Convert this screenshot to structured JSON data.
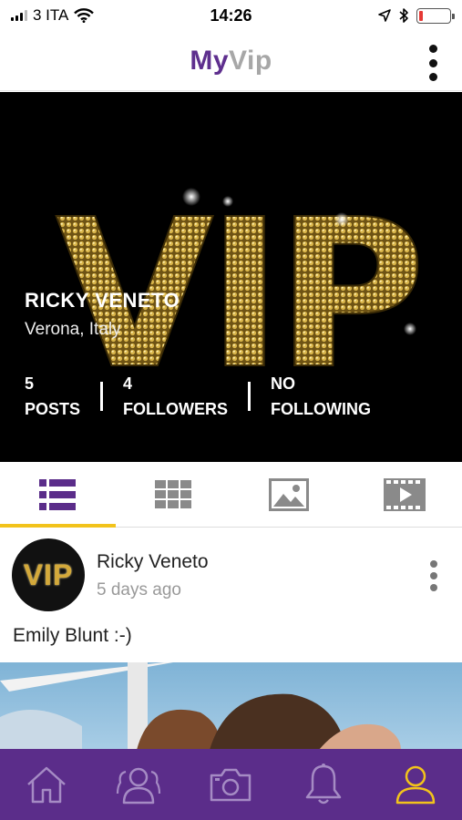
{
  "status_bar": {
    "carrier": "3 ITA",
    "time": "14:26",
    "battery_level": 0.12,
    "icons": [
      "signal-icon",
      "wifi-icon",
      "location-arrow-icon",
      "bluetooth-icon",
      "battery-icon"
    ]
  },
  "header": {
    "title_part1": "My",
    "title_part2": "Vip",
    "menu_icon": "vertical-dots-icon"
  },
  "profile": {
    "cover_text": "VIP",
    "name": "RICKY VENETO",
    "location": "Verona, Italy",
    "stats": [
      {
        "value": "5",
        "label": "POSTS"
      },
      {
        "value": "4",
        "label": "FOLLOWERS"
      },
      {
        "value": "NO",
        "label": "FOLLOWING"
      }
    ]
  },
  "tabs": [
    {
      "icon": "list-icon",
      "active": true
    },
    {
      "icon": "grid-icon",
      "active": false
    },
    {
      "icon": "photo-icon",
      "active": false
    },
    {
      "icon": "video-icon",
      "active": false
    }
  ],
  "post": {
    "avatar_text": "VIP",
    "author": "Ricky Veneto",
    "time": "5 days ago",
    "caption": "Emily Blunt :-)"
  },
  "bottom_nav": [
    {
      "icon": "home-icon"
    },
    {
      "icon": "friends-icon"
    },
    {
      "icon": "camera-icon"
    },
    {
      "icon": "bell-icon"
    },
    {
      "icon": "profile-icon",
      "active": true
    }
  ],
  "colors": {
    "brand_purple": "#5b2d8a",
    "accent_yellow": "#f2c31b",
    "title_gray": "#a7a7a7",
    "gold": "#c9a23a"
  }
}
